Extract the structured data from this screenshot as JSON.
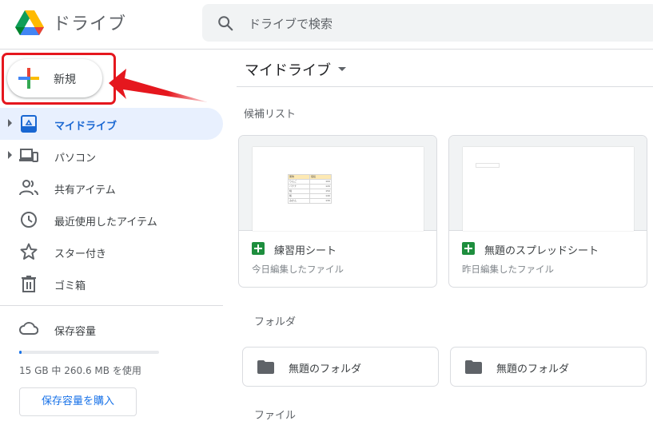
{
  "app": {
    "title": "ドライブ"
  },
  "search": {
    "placeholder": "ドライブで検索"
  },
  "sidebar": {
    "new_label": "新規",
    "items": [
      {
        "label": "マイドライブ",
        "icon": "my-drive-icon",
        "active": true,
        "expandable": true
      },
      {
        "label": "パソコン",
        "icon": "computers-icon",
        "active": false,
        "expandable": true
      },
      {
        "label": "共有アイテム",
        "icon": "shared-icon",
        "active": false,
        "expandable": false
      },
      {
        "label": "最近使用したアイテム",
        "icon": "clock-icon",
        "active": false,
        "expandable": false
      },
      {
        "label": "スター付き",
        "icon": "star-icon",
        "active": false,
        "expandable": false
      },
      {
        "label": "ゴミ箱",
        "icon": "trash-icon",
        "active": false,
        "expandable": false
      }
    ],
    "storage": {
      "label": "保存容量",
      "usage_text": "15 GB 中 260.6 MB を使用",
      "used_fraction": 0.017,
      "buy_label": "保存容量を購入"
    }
  },
  "main": {
    "title": "マイドライブ",
    "suggested_label": "候補リスト",
    "cards": [
      {
        "name": "練習用シート",
        "date": "今日編集したファイル",
        "preview": {
          "headers": [
            "果物",
            "値段"
          ],
          "rows": [
            [
              "りんご",
              "100"
            ],
            [
              "バナナ",
              "120"
            ],
            [
              "桃",
              "150"
            ],
            [
              "梨",
              "140"
            ],
            [
              "みかん",
              "130"
            ]
          ]
        }
      },
      {
        "name": "無題のスプレッドシート",
        "date": "昨日編集したファイル"
      }
    ],
    "folders_label": "フォルダ",
    "folders": [
      {
        "name": "無題のフォルダ"
      },
      {
        "name": "無題のフォルダ"
      }
    ],
    "files_label": "ファイル"
  },
  "colors": {
    "accent": "#1a73e8",
    "active_bg": "#e8f0fe",
    "highlight_red": "#e5171e",
    "sheets_green": "#1e8e3e"
  }
}
